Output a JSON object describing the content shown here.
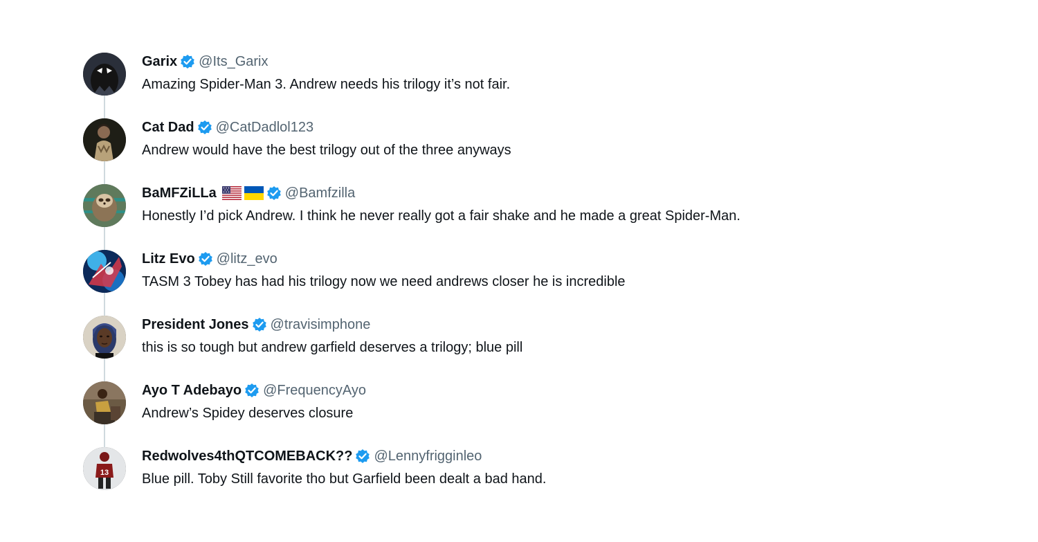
{
  "replies": [
    {
      "name": "Garix",
      "handle": "@Its_Garix",
      "text": "Amazing Spider-Man 3. Andrew needs his trilogy it’s not fair.",
      "avatar_icon": "black-spiderman-avatar"
    },
    {
      "name": "Cat Dad",
      "handle": "@CatDadlol123",
      "text": "Andrew would have the best trilogy out of the three anyways",
      "avatar_icon": "person-portrait-avatar"
    },
    {
      "name": "BaMFZiLLa",
      "flags": [
        "🇺🇸",
        "🇺🇦"
      ],
      "handle": "@Bamfzilla",
      "text": "Honestly I’d pick Andrew. I think he never really got a fair shake and he made a great Spider-Man.",
      "avatar_icon": "sloth-avatar"
    },
    {
      "name": "Litz Evo",
      "handle": "@litz_evo",
      "text": "TASM 3 Tobey has had his trilogy now we need andrews closer he is incredible",
      "avatar_icon": "blue-spiderman-avatar"
    },
    {
      "name": "President Jones",
      "handle": "@travisimphone",
      "text": "this is so tough but andrew garfield deserves a trilogy; blue pill",
      "avatar_icon": "man-with-dreads-avatar"
    },
    {
      "name": "Ayo T Adebayo",
      "handle": "@FrequencyAyo",
      "text": "Andrew’s Spidey deserves closure",
      "avatar_icon": "person-sitting-avatar"
    },
    {
      "name": "Redwolves4thQTCOMEBACK??",
      "handle": "@Lennyfrigginleo",
      "text": "Blue pill. Toby Still favorite tho but Garfield been dealt a bad hand.",
      "avatar_icon": "football-player-avatar"
    }
  ],
  "colors": {
    "verified_badge": "#1d9bf0",
    "handle": "#536471",
    "text": "#0f1419",
    "thread_line": "#cfd9de"
  }
}
